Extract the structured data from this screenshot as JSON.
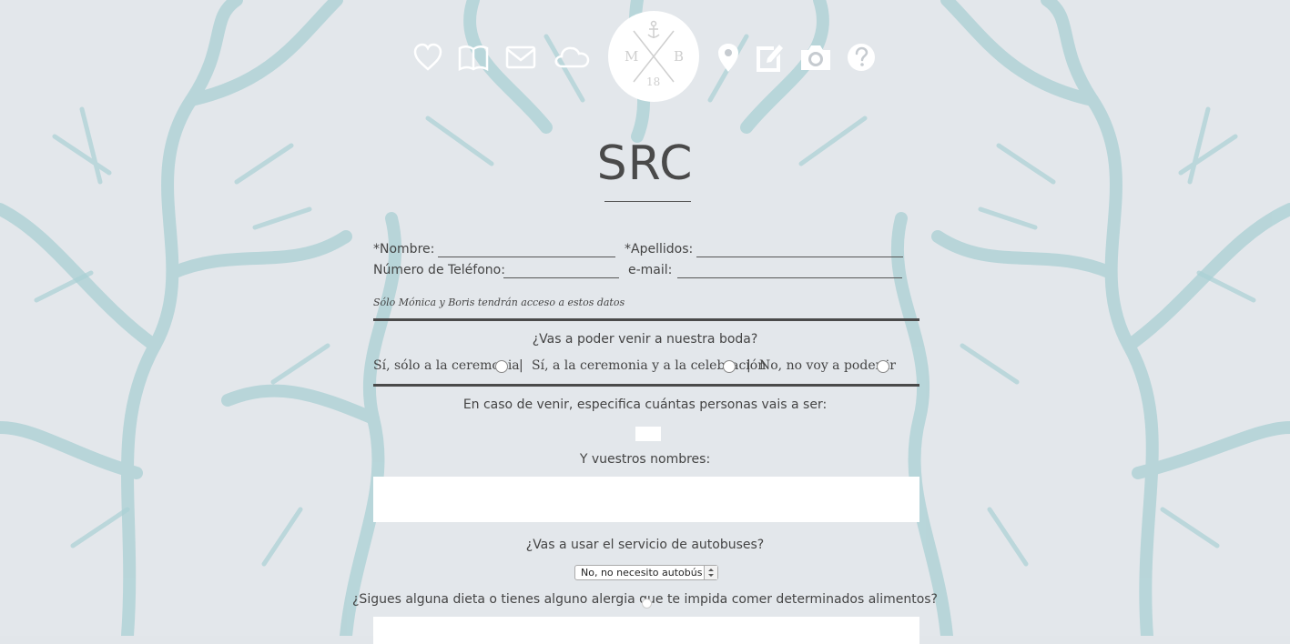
{
  "nav": {
    "items": [
      {
        "icon": "heart-icon"
      },
      {
        "icon": "book-icon"
      },
      {
        "icon": "envelope-icon"
      },
      {
        "icon": "cloud-icon"
      },
      {
        "icon": "map-pin-icon"
      },
      {
        "icon": "edit-note-icon"
      },
      {
        "icon": "camera-icon"
      },
      {
        "icon": "help-icon"
      }
    ],
    "logo": {
      "left": "M",
      "right": "B",
      "bottom": "18"
    }
  },
  "page_title": "SRC",
  "form": {
    "nombre_label": "*Nombre:",
    "apellidos_label": "*Apellidos:",
    "telefono_label": "Número de Teléfono:",
    "email_label": "e-mail:",
    "privacy_note": "Sólo Mónica y Boris tendrán acceso a estos datos",
    "attend_question": "¿Vas a poder venir a nuestra boda?",
    "attend_options": [
      "Sí, sólo a la ceremonia",
      "Sí, a la ceremonia y a la celebración",
      "No, no voy a poder ir"
    ],
    "separator": "|",
    "count_question": "En caso de venir, especifica cuántas personas vais a ser:",
    "names_question": "Y vuestros nombres:",
    "bus_question": "¿Vas a usar el servicio de autobuses?",
    "bus_selected": "No, no necesito autobús",
    "diet_question": "¿Sigues alguna dieta o tienes alguno alergia que te impida comer determinados alimentos?"
  },
  "colors": {
    "background": "#e2e6ea",
    "tree": "#a9cfd3",
    "text": "#444444",
    "white": "#ffffff"
  }
}
